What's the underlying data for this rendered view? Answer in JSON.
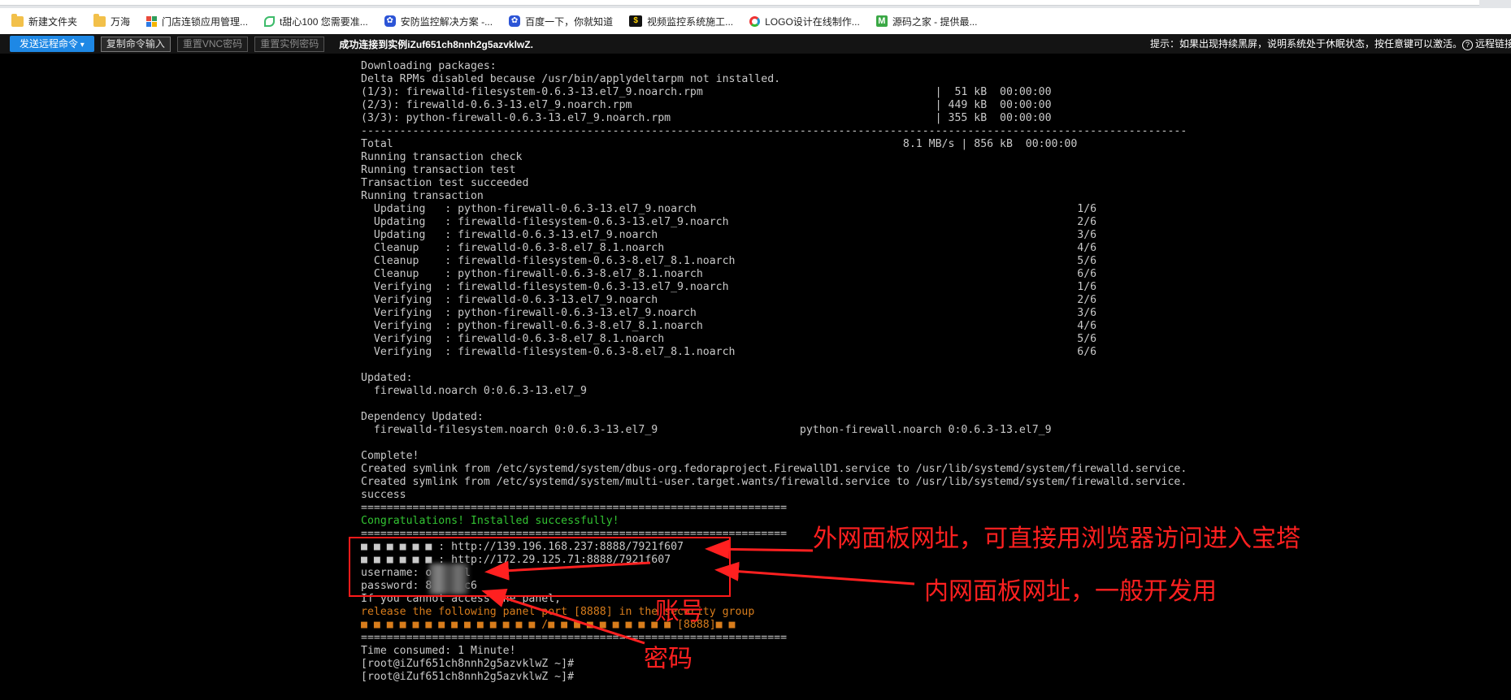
{
  "bookmarks": [
    {
      "label": "新建文件夹",
      "icon": "folder-icon"
    },
    {
      "label": "万海",
      "icon": "folder-icon"
    },
    {
      "label": "门店连锁应用管理...",
      "icon": "grid-icon"
    },
    {
      "label": "t甜心100 您需要准...",
      "icon": "leaf-icon"
    },
    {
      "label": "安防监控解决方案 -...",
      "icon": "paw-icon"
    },
    {
      "label": "百度一下，你就知道",
      "icon": "paw-icon"
    },
    {
      "label": "视频监控系统施工...",
      "icon": "bt-icon"
    },
    {
      "label": "LOGO设计在线制作...",
      "icon": "circle-icon"
    },
    {
      "label": "源码之家 - 提供最...",
      "icon": "m-icon"
    }
  ],
  "toolbar": {
    "send_label": "发送远程命令",
    "copy_label": "复制命令输入",
    "reset_vnc_label": "重置VNC密码",
    "reset_instance_label": "重置实例密码",
    "status": "成功连接到实例iZuf651ch8nnh2g5azvklwZ.",
    "hint": "提示：如果出现持续黑屏，说明系统处于休眠状态，按任意键可以激活。",
    "help_label": "远程链接"
  },
  "terminal": {
    "lines": [
      {
        "text": "Downloading packages:",
        "color": "default"
      },
      {
        "text": "Delta RPMs disabled because /usr/bin/applydeltarpm not installed.",
        "color": "default"
      },
      {
        "text": "(1/3): firewalld-filesystem-0.6.3-13.el7_9.noarch.rpm                                    |  51 kB  00:00:00",
        "color": "default"
      },
      {
        "text": "(2/3): firewalld-0.6.3-13.el7_9.noarch.rpm                                               | 449 kB  00:00:00",
        "color": "default"
      },
      {
        "text": "(3/3): python-firewall-0.6.3-13.el7_9.noarch.rpm                                         | 355 kB  00:00:00",
        "color": "default"
      },
      {
        "text": "--------------------------------------------------------------------------------------------------------------------------------",
        "color": "default"
      },
      {
        "text": "Total                                                                               8.1 MB/s | 856 kB  00:00:00",
        "color": "default"
      },
      {
        "text": "Running transaction check",
        "color": "default"
      },
      {
        "text": "Running transaction test",
        "color": "default"
      },
      {
        "text": "Transaction test succeeded",
        "color": "default"
      },
      {
        "text": "Running transaction",
        "color": "default"
      },
      {
        "text": "  Updating   : python-firewall-0.6.3-13.el7_9.noarch                                                           1/6",
        "color": "default"
      },
      {
        "text": "  Updating   : firewalld-filesystem-0.6.3-13.el7_9.noarch                                                      2/6",
        "color": "default"
      },
      {
        "text": "  Updating   : firewalld-0.6.3-13.el7_9.noarch                                                                 3/6",
        "color": "default"
      },
      {
        "text": "  Cleanup    : firewalld-0.6.3-8.el7_8.1.noarch                                                                4/6",
        "color": "default"
      },
      {
        "text": "  Cleanup    : firewalld-filesystem-0.6.3-8.el7_8.1.noarch                                                     5/6",
        "color": "default"
      },
      {
        "text": "  Cleanup    : python-firewall-0.6.3-8.el7_8.1.noarch                                                          6/6",
        "color": "default"
      },
      {
        "text": "  Verifying  : firewalld-filesystem-0.6.3-13.el7_9.noarch                                                      1/6",
        "color": "default"
      },
      {
        "text": "  Verifying  : firewalld-0.6.3-13.el7_9.noarch                                                                 2/6",
        "color": "default"
      },
      {
        "text": "  Verifying  : python-firewall-0.6.3-13.el7_9.noarch                                                           3/6",
        "color": "default"
      },
      {
        "text": "  Verifying  : python-firewall-0.6.3-8.el7_8.1.noarch                                                          4/6",
        "color": "default"
      },
      {
        "text": "  Verifying  : firewalld-0.6.3-8.el7_8.1.noarch                                                                5/6",
        "color": "default"
      },
      {
        "text": "  Verifying  : firewalld-filesystem-0.6.3-8.el7_8.1.noarch                                                     6/6",
        "color": "default"
      },
      {
        "text": "",
        "color": "default"
      },
      {
        "text": "Updated:",
        "color": "default"
      },
      {
        "text": "  firewalld.noarch 0:0.6.3-13.el7_9",
        "color": "default"
      },
      {
        "text": "",
        "color": "default"
      },
      {
        "text": "Dependency Updated:",
        "color": "default"
      },
      {
        "text": "  firewalld-filesystem.noarch 0:0.6.3-13.el7_9                      python-firewall.noarch 0:0.6.3-13.el7_9",
        "color": "default"
      },
      {
        "text": "",
        "color": "default"
      },
      {
        "text": "Complete!",
        "color": "default"
      },
      {
        "text": "Created symlink from /etc/systemd/system/dbus-org.fedoraproject.FirewallD1.service to /usr/lib/systemd/system/firewalld.service.",
        "color": "default"
      },
      {
        "text": "Created symlink from /etc/systemd/system/multi-user.target.wants/firewalld.service to /usr/lib/systemd/system/firewalld.service.",
        "color": "default"
      },
      {
        "text": "success",
        "color": "default"
      },
      {
        "text": "==================================================================",
        "color": "default"
      },
      {
        "text": "Congratulations! Installed successfully!",
        "color": "green"
      },
      {
        "text": "==================================================================",
        "color": "default"
      },
      {
        "text": "■ ■ ■ ■ ■ ■ : http://139.196.168.237:8888/7921f607",
        "color": "default"
      },
      {
        "text": "■ ■ ■ ■ ■ ■ : http://172.29.125.71:8888/7921f607",
        "color": "default"
      },
      {
        "text": "username: o     l",
        "color": "default"
      },
      {
        "text": "password: 8     c6",
        "color": "default"
      },
      {
        "text": "If you cannot access the panel,",
        "color": "red"
      },
      {
        "text": "release the following panel port [8888] in the security group",
        "color": "orange"
      },
      {
        "text": "■ ■ ■ ■ ■ ■ ■ ■ ■ ■ ■ ■ ■ ■ /■ ■ ■ ■ ■ ■ ■ ■ ■ ■ [8888]■ ■",
        "color": "orange"
      },
      {
        "text": "==================================================================",
        "color": "default"
      },
      {
        "text": "Time consumed: 1 Minute!",
        "color": "default"
      },
      {
        "text": "[root@iZuf651ch8nnh2g5azvklwZ ~]#",
        "color": "default"
      },
      {
        "text": "[root@iZuf651ch8nnh2g5azvklwZ ~]#",
        "color": "default"
      }
    ]
  },
  "annotations": {
    "outer_panel": "外网面板网址，可直接用浏览器访问进入宝塔",
    "inner_panel": "内网面板网址，一般开发用",
    "account": "账号",
    "password": "密码"
  },
  "colors": {
    "terminal_text": "#c9c9c9",
    "success": "#33c433",
    "warning": "#d87d1c",
    "annotation": "#ff2020",
    "send_button": "#1e88e5"
  }
}
